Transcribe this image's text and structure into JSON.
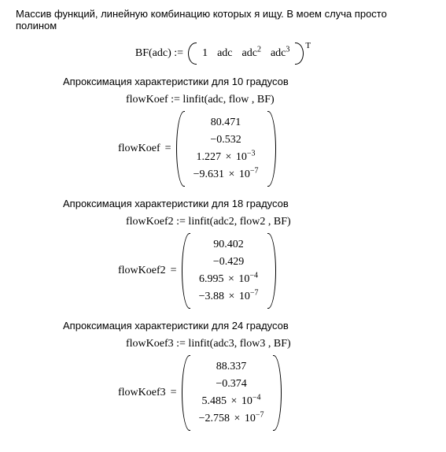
{
  "intro": "Массив функций, линейную комбинацию которых я ищу. В моем случа просто полином",
  "bf": {
    "lhs": "BF(adc) :=",
    "elems": [
      "1",
      "adc",
      "adc",
      "adc"
    ],
    "powers": [
      "",
      "",
      "2",
      "3"
    ],
    "transpose": "T"
  },
  "sections": [
    {
      "label": "Апроксимация характеристики для 10 градусов",
      "assign": "flowKoef  := linfit(adc, flow , BF)",
      "result_name": "flowKoef",
      "eq": "=",
      "rows": [
        {
          "plain": "80.471"
        },
        {
          "plain": "−0.532"
        },
        {
          "mantissa": "1.227",
          "times": "×",
          "base": "10",
          "exp": "−3"
        },
        {
          "mantissa": "−9.631",
          "times": "×",
          "base": "10",
          "exp": "−7"
        }
      ]
    },
    {
      "label": "Апроксимация характеристики для 18 градусов",
      "assign": "flowKoef2 := linfit(adc2, flow2 , BF)",
      "result_name": "flowKoef2",
      "eq": "=",
      "rows": [
        {
          "plain": "90.402"
        },
        {
          "plain": "−0.429"
        },
        {
          "mantissa": "6.995",
          "times": "×",
          "base": "10",
          "exp": "−4"
        },
        {
          "mantissa": "−3.88",
          "times": "×",
          "base": "10",
          "exp": "−7"
        }
      ]
    },
    {
      "label": "Апроксимация характеристики для 24 градусов",
      "assign": "flowKoef3 := linfit(adc3, flow3 , BF)",
      "result_name": "flowKoef3",
      "eq": "=",
      "rows": [
        {
          "plain": "88.337"
        },
        {
          "plain": "−0.374"
        },
        {
          "mantissa": "5.485",
          "times": "×",
          "base": "10",
          "exp": "−4"
        },
        {
          "mantissa": "−2.758",
          "times": "×",
          "base": "10",
          "exp": "−7"
        }
      ]
    }
  ]
}
